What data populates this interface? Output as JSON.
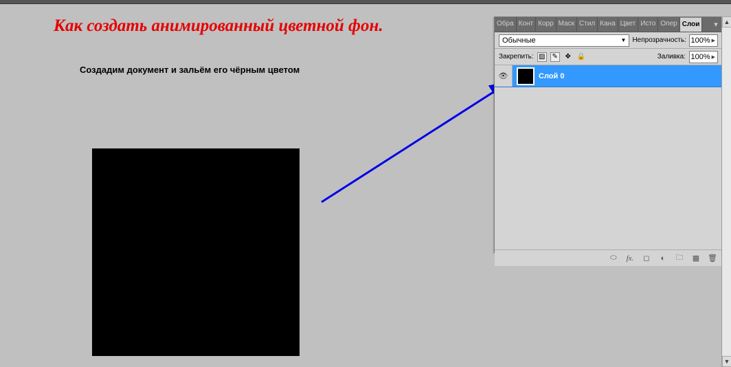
{
  "title": "Как создать анимированный цветной фон.",
  "instruction": "Создадим документ и зальём его чёрным цветом",
  "panel": {
    "tabs": [
      "Обра",
      "Конт",
      "Корр",
      "Маск",
      "Стил",
      "Кана",
      "Цвет",
      "Исто",
      "Опер"
    ],
    "active_tab": "Слои",
    "blend_mode": "Обычные",
    "opacity_label": "Непрозрачность:",
    "opacity_value": "100%",
    "lock_label": "Закрепить:",
    "fill_label": "Заливка:",
    "fill_value": "100%",
    "layer": {
      "name": "Слой 0"
    }
  }
}
